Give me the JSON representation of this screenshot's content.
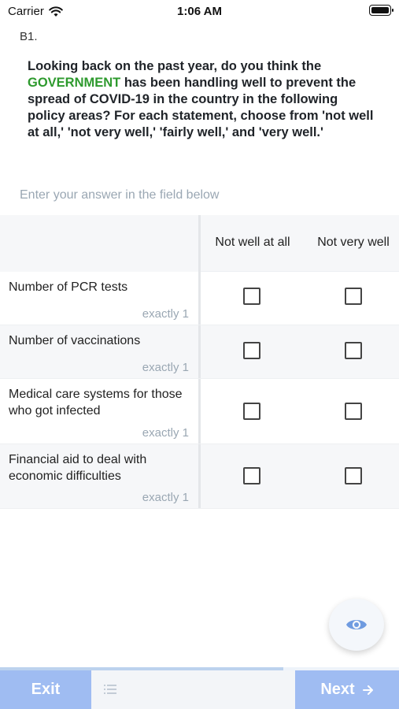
{
  "status_bar": {
    "carrier": "Carrier",
    "time": "1:06 AM"
  },
  "question": {
    "number": "B1.",
    "text_before": "Looking back on the past year, do you think the ",
    "highlight": "GOVERNMENT",
    "text_after": " has been handling well to prevent the spread of COVID-19 in the country in the following policy areas? For each statement, choose from 'not well at all,' 'not very well,' 'fairly well,' and 'very well.'",
    "highlight_color": "#2e9a2e"
  },
  "instruction": "Enter your answer in the field below",
  "grid": {
    "columns": [
      "Not well at all",
      "Not very well"
    ],
    "rows": [
      {
        "label": "Number of PCR tests",
        "hint": "exactly 1",
        "checked": [
          false,
          false
        ]
      },
      {
        "label": "Number of vaccinations",
        "hint": "exactly 1",
        "checked": [
          false,
          false
        ]
      },
      {
        "label": "Medical care systems for those who got infected",
        "hint": "exactly 1",
        "checked": [
          false,
          false
        ]
      },
      {
        "label": "Financial aid to deal with economic difficulties",
        "hint": "exactly 1",
        "checked": [
          false,
          false
        ]
      }
    ]
  },
  "footer": {
    "exit_label": "Exit",
    "next_label": "Next",
    "accent": "#9fbcf2"
  },
  "progress": {
    "fraction": 0.71
  },
  "icons": {
    "eye": "eye-icon",
    "list": "list-icon",
    "arrow": "arrow-right-icon",
    "wifi": "wifi-icon",
    "battery": "battery-icon"
  }
}
